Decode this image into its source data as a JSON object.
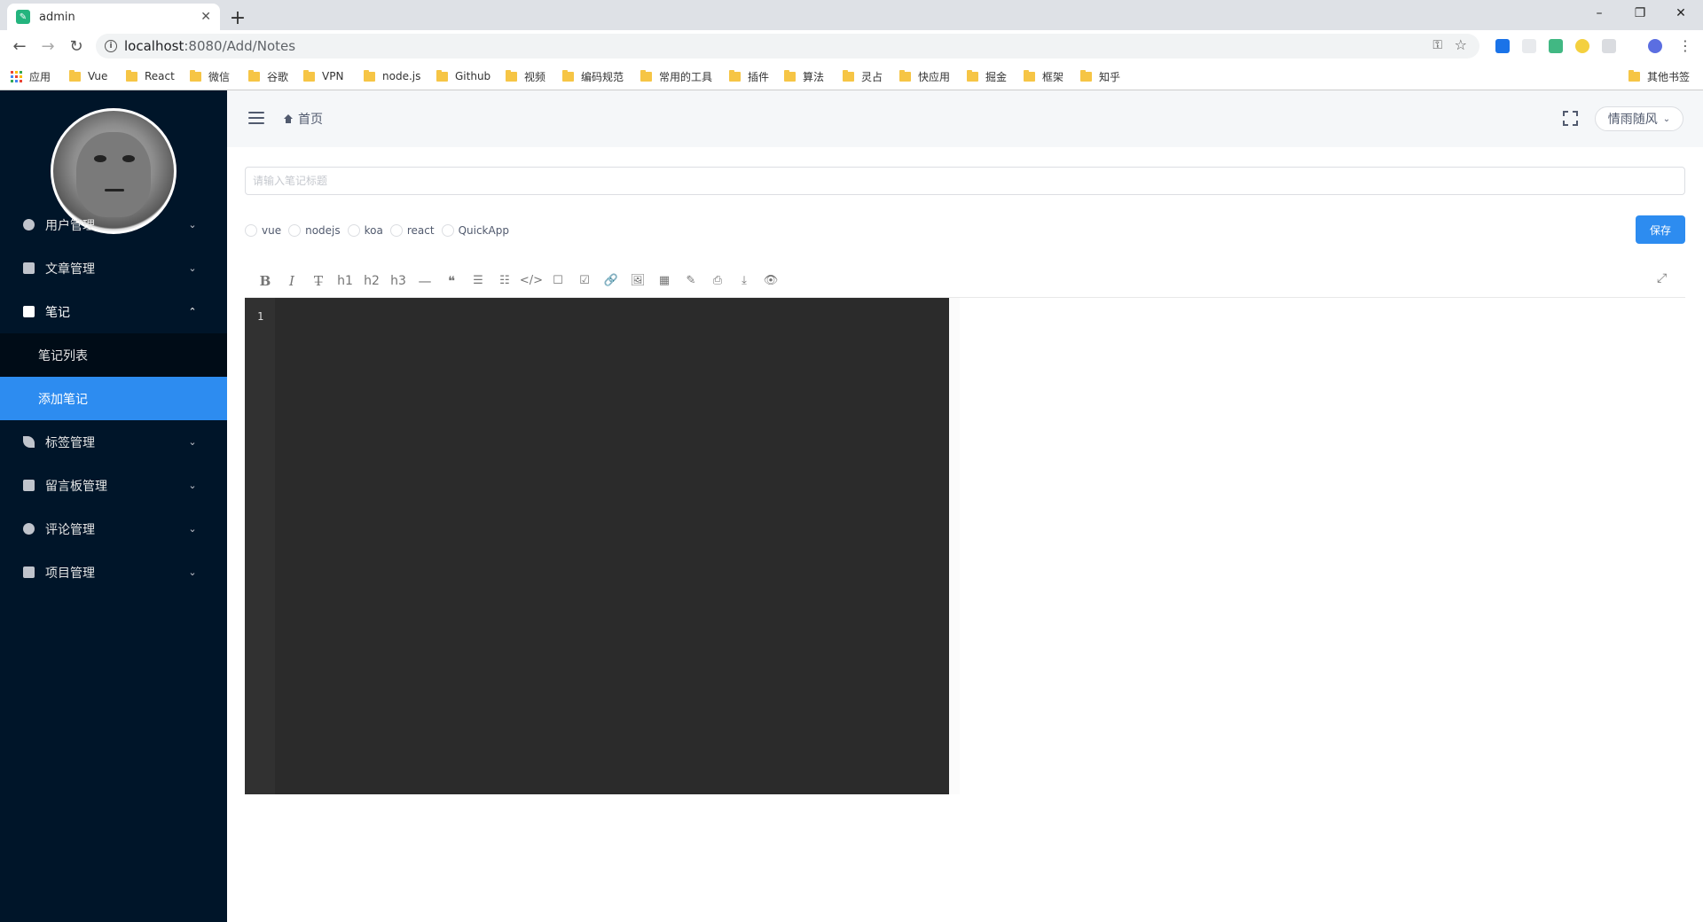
{
  "browser": {
    "tab_title": "admin",
    "new_tab": "+",
    "tab_close": "✕",
    "url_host": "localhost",
    "url_path": ":8080/Add/Notes",
    "window_controls": [
      "–",
      "❐",
      "✕"
    ]
  },
  "bookmarks": [
    {
      "label": "应用",
      "type": "apps"
    },
    {
      "label": "Vue",
      "type": "folder"
    },
    {
      "label": "React",
      "type": "folder"
    },
    {
      "label": "微信",
      "type": "folder"
    },
    {
      "label": "谷歌",
      "type": "folder"
    },
    {
      "label": "VPN",
      "type": "folder"
    },
    {
      "label": "node.js",
      "type": "folder"
    },
    {
      "label": "Github",
      "type": "folder"
    },
    {
      "label": "视频",
      "type": "folder"
    },
    {
      "label": "编码规范",
      "type": "folder"
    },
    {
      "label": "常用的工具",
      "type": "folder"
    },
    {
      "label": "插件",
      "type": "folder"
    },
    {
      "label": "算法",
      "type": "folder"
    },
    {
      "label": "灵占",
      "type": "folder"
    },
    {
      "label": "快应用",
      "type": "folder"
    },
    {
      "label": "掘金",
      "type": "folder"
    },
    {
      "label": "框架",
      "type": "folder"
    },
    {
      "label": "知乎",
      "type": "folder"
    },
    {
      "label": "其他书签",
      "type": "folder"
    }
  ],
  "sidebar": {
    "menu": [
      {
        "label": "用户管理",
        "icon": "github-icon",
        "arrow": "⌄"
      },
      {
        "label": "文章管理",
        "icon": "document-icon",
        "arrow": "⌄"
      },
      {
        "label": "笔记",
        "icon": "notebook-icon",
        "arrow": "⌃"
      },
      {
        "label": "标签管理",
        "icon": "leaf-icon",
        "arrow": "⌄"
      },
      {
        "label": "留言板管理",
        "icon": "newspaper-icon",
        "arrow": "⌄"
      },
      {
        "label": "评论管理",
        "icon": "chat-icon",
        "arrow": "⌄"
      },
      {
        "label": "项目管理",
        "icon": "grid-icon",
        "arrow": "⌄"
      }
    ],
    "submenu": [
      {
        "label": "笔记列表",
        "active": false
      },
      {
        "label": "添加笔记",
        "active": true
      }
    ]
  },
  "header": {
    "breadcrumb": "首页",
    "username": "情雨随风",
    "caret": "⌄"
  },
  "form": {
    "title_placeholder": "请输入笔记标题",
    "categories": [
      "vue",
      "nodejs",
      "koa",
      "react",
      "QuickApp"
    ],
    "save_label": "保存"
  },
  "editor": {
    "toolbar": [
      "B",
      "I",
      "T̶",
      "h1",
      "h2",
      "h3",
      "—",
      "❝",
      "☰",
      "☷",
      "</>",
      "☐",
      "☑",
      "🔗",
      "🖼",
      "▦",
      "✎",
      "⎙",
      "⤓",
      "👁"
    ],
    "fullscreen": "⤢",
    "line_numbers": [
      "1"
    ]
  },
  "colors": {
    "sidebar_bg": "#001529",
    "accent": "#2d8cf0",
    "editor_bg": "#2b2b2b"
  }
}
